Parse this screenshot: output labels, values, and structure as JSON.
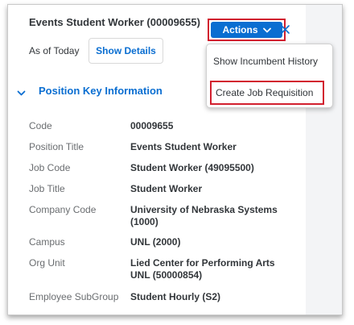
{
  "header": {
    "title": "Events Student Worker (00009655)",
    "actions_label": "Actions",
    "as_of_label": "As of Today",
    "show_details_label": "Show Details"
  },
  "actions_menu": {
    "items": [
      {
        "label": "Show Incumbent History"
      },
      {
        "label": "Create Job Requisition"
      }
    ]
  },
  "section": {
    "title": "Position Key Information",
    "rows": [
      {
        "label": "Code",
        "value": "00009655"
      },
      {
        "label": "Position Title",
        "value": "Events Student Worker"
      },
      {
        "label": "Job Code",
        "value": "Student Worker (49095500)"
      },
      {
        "label": "Job Title",
        "value": "Student Worker"
      },
      {
        "label": "Company Code",
        "value": "University of Nebraska Systems (1000)"
      },
      {
        "label": "Campus",
        "value": "UNL (2000)"
      },
      {
        "label": "Org Unit",
        "value": "Lied Center for Performing Arts UNL (50000854)"
      },
      {
        "label": "Employee SubGroup",
        "value": "Student Hourly (S2)"
      }
    ]
  },
  "icons": {
    "actions_dropdown": "chevron-down-icon",
    "close": "close-icon",
    "section_toggle": "chevron-down-icon"
  },
  "colors": {
    "accent": "#0a6ed1",
    "highlight": "#d2202f"
  }
}
